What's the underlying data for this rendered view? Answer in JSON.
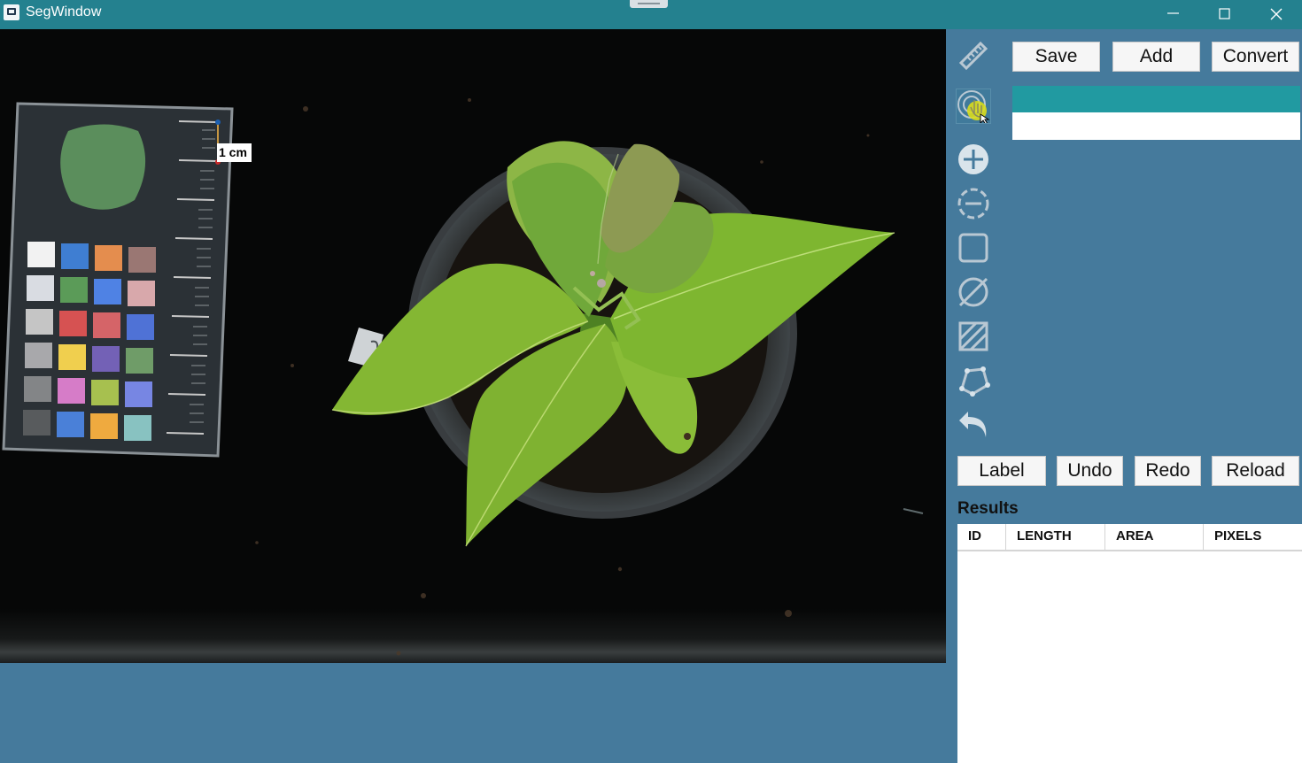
{
  "window": {
    "title": "SegWindow"
  },
  "canvas": {
    "scale_label": "1 cm"
  },
  "toolbar": {
    "save_label": "Save",
    "add_label": "Add",
    "convert_label": "Convert",
    "label_label": "Label",
    "undo_label": "Undo",
    "redo_label": "Redo",
    "reload_label": "Reload"
  },
  "tools": [
    "ruler-icon",
    "touch-select-icon",
    "add-circle-icon",
    "subtract-dashed-circle-icon",
    "rectangle-icon",
    "no-entry-icon",
    "rectangle-cross-icon",
    "polygon-icon",
    "undo-arrow-icon"
  ],
  "results": {
    "title": "Results",
    "columns": [
      "ID",
      "LENGTH",
      "AREA",
      "PIXELS"
    ],
    "rows": []
  },
  "colors": {
    "titlebar": "#24818f",
    "panel": "#457a9c",
    "selected_list_row": "#219aa1"
  }
}
